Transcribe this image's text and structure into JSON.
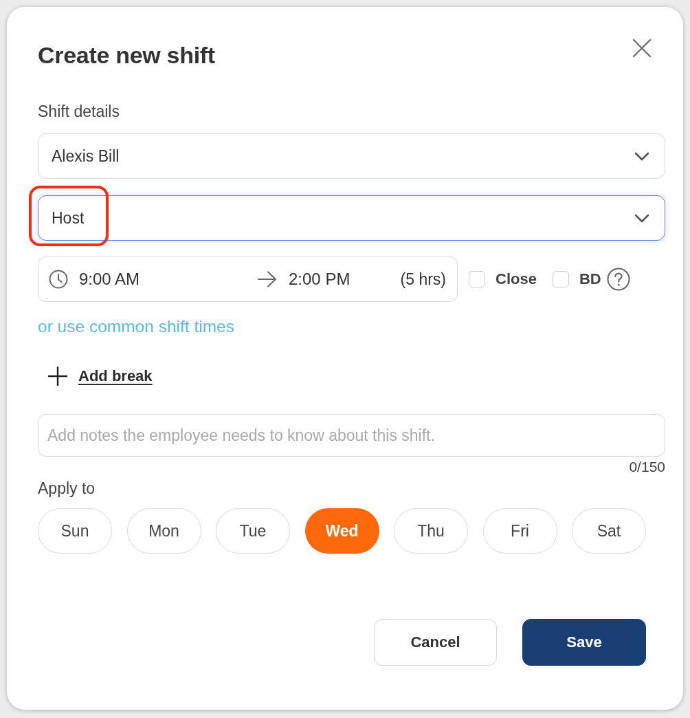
{
  "dialog": {
    "title": "Create new shift"
  },
  "section_label": "Shift details",
  "fields": [
    {
      "kind": "select",
      "value": "Alexis Bill",
      "focused": false,
      "highlighted": false
    },
    {
      "kind": "select",
      "value": "Host",
      "focused": true,
      "highlighted": true
    }
  ],
  "time_range": {
    "start": "9:00 AM",
    "end": "2:00 PM",
    "duration": "(5 hrs)"
  },
  "options": [
    {
      "label": "Close",
      "checked": false,
      "help": false
    },
    {
      "label": "BD",
      "checked": false,
      "help": true
    }
  ],
  "common_times_link": "or use common shift times",
  "add_break": "Add break",
  "notes": {
    "placeholder": "Add notes the employee needs to know about this shift.",
    "counter": "0/150"
  },
  "apply_to": {
    "label": "Apply to",
    "days": [
      {
        "label": "Sun",
        "selected": false
      },
      {
        "label": "Mon",
        "selected": false
      },
      {
        "label": "Tue",
        "selected": false
      },
      {
        "label": "Wed",
        "selected": true
      },
      {
        "label": "Thu",
        "selected": false
      },
      {
        "label": "Fri",
        "selected": false
      },
      {
        "label": "Sat",
        "selected": false
      }
    ]
  },
  "actions": [
    {
      "label": "Cancel",
      "kind": "secondary"
    },
    {
      "label": "Save",
      "kind": "primary"
    }
  ]
}
